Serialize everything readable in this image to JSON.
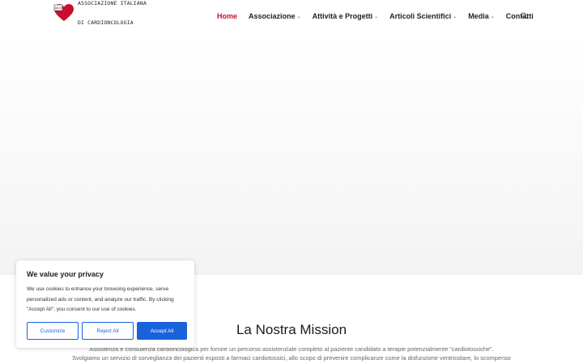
{
  "header": {
    "logo_line1": "ASSOCIAZIONE ITALIANA",
    "logo_line2": "DI CARDIONCOLOGIA",
    "logo_badge": "AICO",
    "nav": [
      {
        "label": "Home",
        "active": true
      },
      {
        "label": "Associazione",
        "dropdown": true
      },
      {
        "label": "Attività e Progetti",
        "dropdown": true
      },
      {
        "label": "Articoli Scientifici",
        "dropdown": true
      },
      {
        "label": "Media",
        "dropdown": true
      },
      {
        "label": "Contatti"
      }
    ],
    "search_icon": "search-icon"
  },
  "mission": {
    "title": "La Nostra Mission",
    "line1": "Assistenza e consulenza cardioncologica per fornire un percorso assistenziale completo al paziente candidato a terapie potenzialmente “cardiotossiche”.",
    "line2": "Svolgiamo un servizio di sorveglianza dei pazienti esposti a farmaci cardiotossici, allo scopo di prevenire complicanze come la disfunzione ventricolare, lo scompenso"
  },
  "cookie_banner": {
    "title": "We value your privacy",
    "text": "We use cookies to enhance your browsing experience, serve personalized ads or content, and analyze our traffic. By clicking \"Accept All\", you consent to our use of cookies.",
    "customize_label": "Customize",
    "reject_label": "Reject All",
    "accept_label": "Accept All"
  },
  "colors": {
    "accent_red": "#c8102e",
    "button_blue": "#1863dc"
  }
}
